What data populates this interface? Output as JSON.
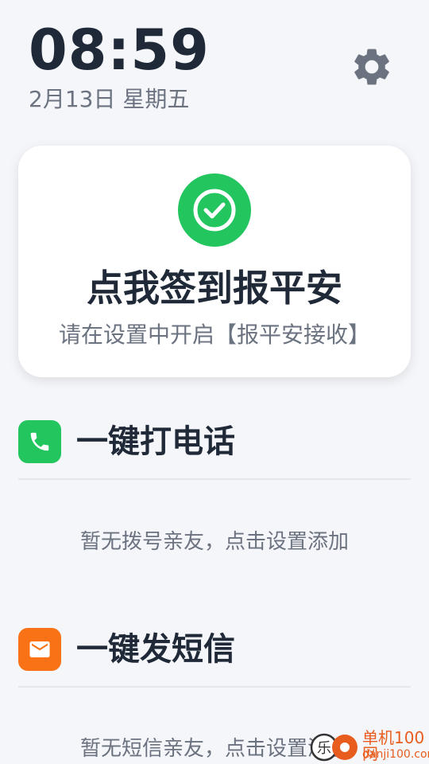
{
  "status": {
    "time": "08:59",
    "date": "2月13日 星期五"
  },
  "checkin": {
    "title": "点我签到报平安",
    "subtitle": "请在设置中开启【报平安接收】",
    "accent_color": "#22c55e"
  },
  "call_section": {
    "title": "一键打电话",
    "icon": "phone-icon",
    "icon_color": "#22c55e",
    "empty_hint": "暂无拨号亲友，点击设置添加"
  },
  "sms_section": {
    "title": "一键发短信",
    "icon": "mail-icon",
    "icon_color": "#f97316",
    "empty_hint": "暂无短信亲友，点击设置添加"
  },
  "settings": {
    "icon": "gear-icon",
    "color": "#6b7280"
  },
  "watermark": {
    "name": "单机100网",
    "url": "danji100.com"
  }
}
